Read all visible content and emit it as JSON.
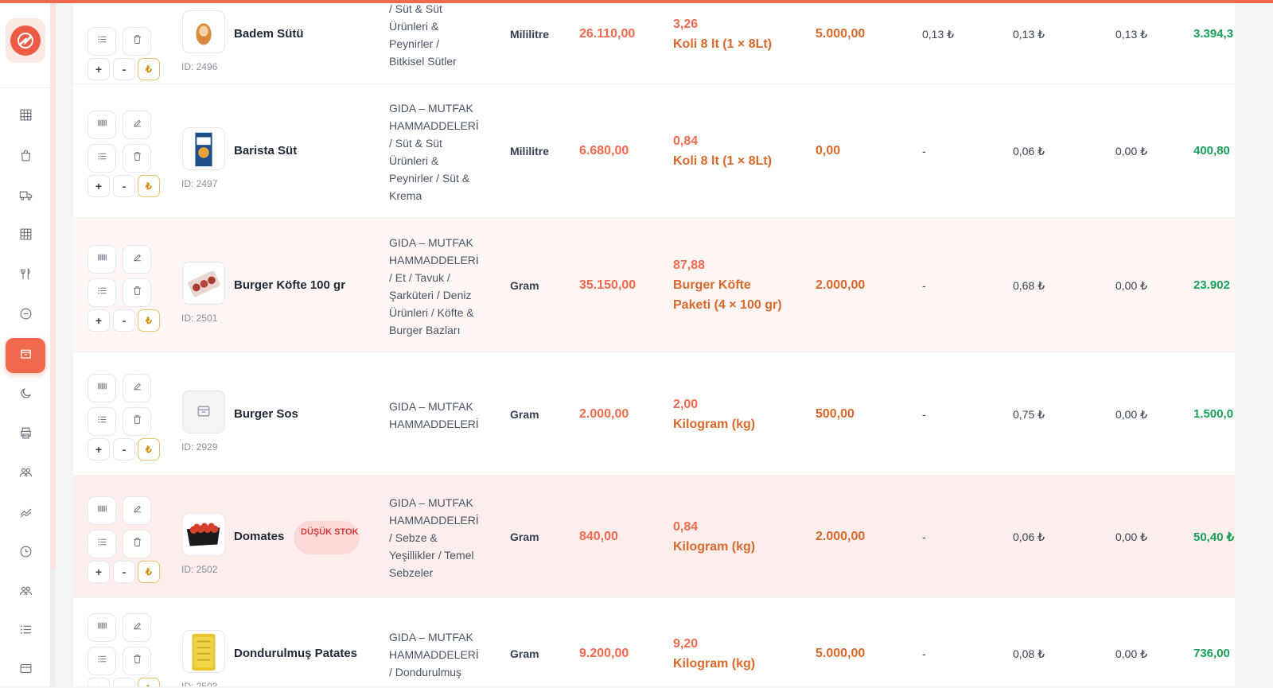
{
  "colors": {
    "accent": "#f16a4e",
    "green": "#18a058",
    "low_stock": "#d13b3b"
  },
  "sidebar": {
    "logo_icon": "brand-logo",
    "items": [
      {
        "icon": "grid-icon"
      },
      {
        "icon": "shopping-bag-icon"
      },
      {
        "icon": "truck-icon"
      },
      {
        "icon": "table-icon"
      },
      {
        "icon": "utensils-icon"
      },
      {
        "icon": "minus-circle-icon"
      },
      {
        "icon": "box-icon",
        "active": true
      },
      {
        "icon": "moon-icon"
      },
      {
        "icon": "printer-icon"
      },
      {
        "icon": "users-icon"
      },
      {
        "icon": "trend-icon"
      },
      {
        "icon": "clock-icon"
      },
      {
        "icon": "team-icon"
      },
      {
        "icon": "list-icon"
      },
      {
        "icon": "card-icon"
      }
    ]
  },
  "rows": [
    {
      "name": "Badem Sütü",
      "id": "ID: 2496",
      "category_lines": [
        "/ Süt & Süt",
        "Ürünleri &",
        "Peynirler /",
        "Bitkisel Sütler"
      ],
      "unit": "Mililitre",
      "stock": "26.110,00",
      "package_price": "3,26",
      "package_lines": [
        "Koli 8 lt (1 × 8Lt)"
      ],
      "quantity": "5.000,00",
      "col_a": "0,13 ₺",
      "col_b": "0,13 ₺",
      "col_c": "0,13 ₺",
      "total": "3.394,3"
    },
    {
      "name": "Barista Süt",
      "id": "ID: 2497",
      "category_lines": [
        "GIDA – MUTFAK",
        "HAMMADDELERİ",
        "/ Süt & Süt",
        "Ürünleri &",
        "Peynirler / Süt &",
        "Krema"
      ],
      "unit": "Mililitre",
      "stock": "6.680,00",
      "package_price": "0,84",
      "package_lines": [
        "Koli 8 lt (1 × 8Lt)"
      ],
      "quantity": "0,00",
      "col_a": "-",
      "col_b": "0,06 ₺",
      "col_c": "0,00 ₺",
      "total": "400,80"
    },
    {
      "name": "Burger Köfte 100 gr",
      "id": "ID: 2501",
      "category_lines": [
        "GIDA – MUTFAK",
        "HAMMADDELERİ",
        "/ Et / Tavuk /",
        "Şarküteri / Deniz",
        "Ürünleri / Köfte &",
        "Burger Bazları"
      ],
      "unit": "Gram",
      "stock": "35.150,00",
      "package_price": "87,88",
      "package_lines": [
        "Burger Köfte",
        "Paketi (4 × 100 gr)"
      ],
      "quantity": "2.000,00",
      "col_a": "-",
      "col_b": "0,68 ₺",
      "col_c": "0,00 ₺",
      "total": "23.902"
    },
    {
      "name": "Burger Sos",
      "id": "ID: 2929",
      "category_lines": [
        "GIDA – MUTFAK",
        "HAMMADDELERİ"
      ],
      "unit": "Gram",
      "stock": "2.000,00",
      "package_price": "2,00",
      "package_lines": [
        "Kilogram (kg)"
      ],
      "quantity": "500,00",
      "col_a": "-",
      "col_b": "0,75 ₺",
      "col_c": "0,00 ₺",
      "total": "1.500,0"
    },
    {
      "name": "Domates",
      "id": "ID: 2502",
      "badge": "DÜŞÜK STOK",
      "category_lines": [
        "GIDA – MUTFAK",
        "HAMMADDELERİ",
        "/ Sebze &",
        "Yeşillikler / Temel",
        "Sebzeler"
      ],
      "unit": "Gram",
      "stock": "840,00",
      "package_price": "0,84",
      "package_lines": [
        "Kilogram (kg)"
      ],
      "quantity": "2.000,00",
      "col_a": "-",
      "col_b": "0,06 ₺",
      "col_c": "0,00 ₺",
      "total": "50,40 ₺"
    },
    {
      "name": "Dondurulmuş Patates",
      "id": "ID: 2503",
      "category_lines": [
        "GIDA – MUTFAK",
        "HAMMADDELERİ",
        "/ Dondurulmuş"
      ],
      "unit": "Gram",
      "stock": "9.200,00",
      "package_price": "9,20",
      "package_lines": [
        "Kilogram (kg)"
      ],
      "quantity": "5.000,00",
      "col_a": "-",
      "col_b": "0,08 ₺",
      "col_c": "0,00 ₺",
      "total": "736,00"
    }
  ],
  "buttons": {
    "plus": "+",
    "minus": "-",
    "lira": "₺"
  }
}
